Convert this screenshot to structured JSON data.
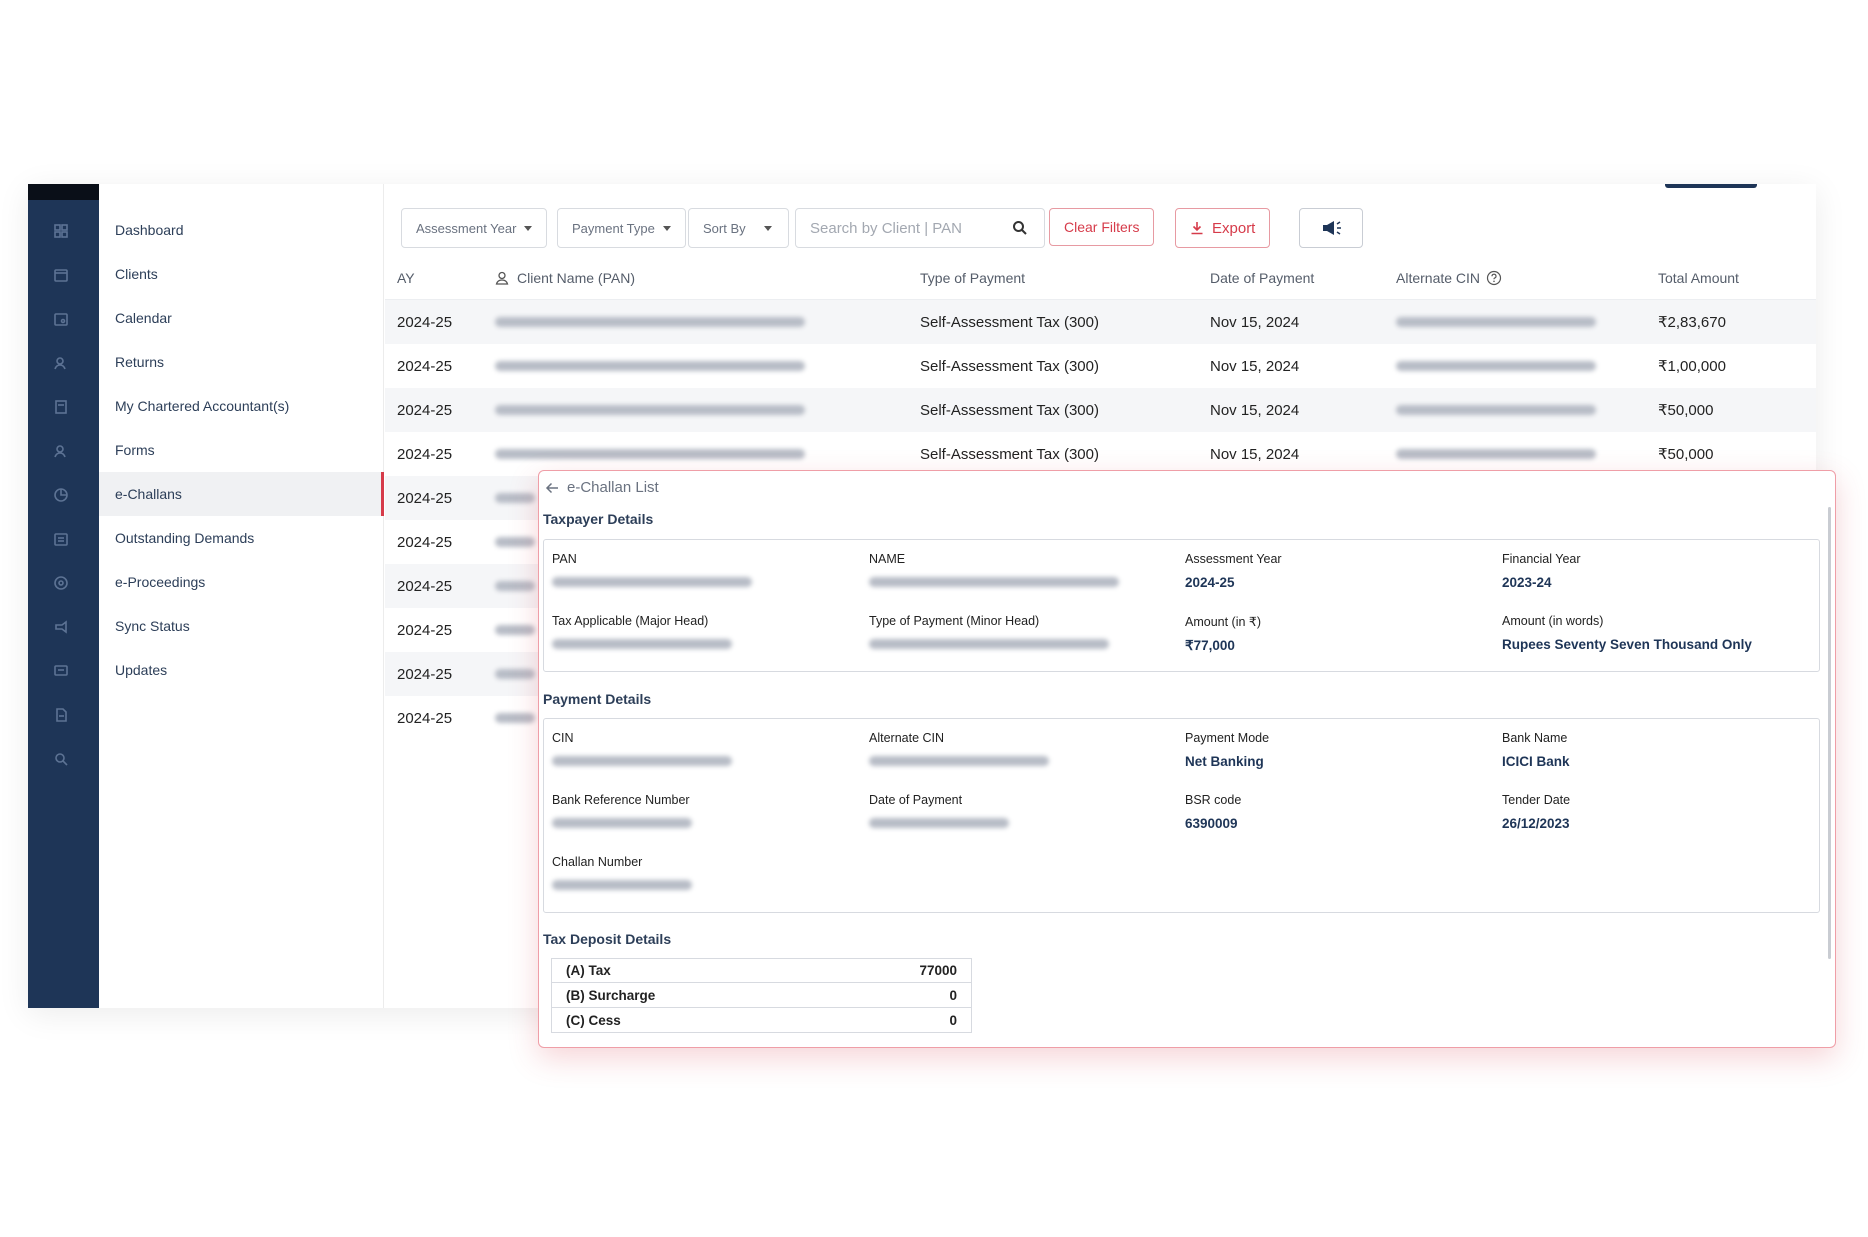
{
  "sidebar": {
    "items": [
      {
        "label": "Dashboard"
      },
      {
        "label": "Clients"
      },
      {
        "label": "Calendar"
      },
      {
        "label": "Returns"
      },
      {
        "label": "My Chartered Accountant(s)"
      },
      {
        "label": "Forms"
      },
      {
        "label": "e-Challans",
        "active": true
      },
      {
        "label": "Outstanding Demands"
      },
      {
        "label": "e-Proceedings"
      },
      {
        "label": "Sync Status"
      },
      {
        "label": "Updates"
      }
    ]
  },
  "toolbar": {
    "assessment_year": "Assessment Year",
    "payment_type": "Payment Type",
    "sort_by": "Sort By",
    "search_placeholder": "Search by Client | PAN",
    "clear_filters": "Clear Filters",
    "export": "Export"
  },
  "table": {
    "columns": [
      "AY",
      "Client Name (PAN)",
      "Type of Payment",
      "Date of Payment",
      "Alternate CIN",
      "Total Amount"
    ],
    "rows": [
      {
        "ay": "2024-25",
        "type": "Self-Assessment Tax (300)",
        "date": "Nov 15, 2024",
        "amount": "₹2,83,670"
      },
      {
        "ay": "2024-25",
        "type": "Self-Assessment Tax (300)",
        "date": "Nov 15, 2024",
        "amount": "₹1,00,000"
      },
      {
        "ay": "2024-25",
        "type": "Self-Assessment Tax (300)",
        "date": "Nov 15, 2024",
        "amount": "₹50,000"
      },
      {
        "ay": "2024-25",
        "type": "Self-Assessment Tax (300)",
        "date": "Nov 15, 2024",
        "amount": "₹50,000"
      },
      {
        "ay": "2024-25"
      },
      {
        "ay": "2024-25"
      },
      {
        "ay": "2024-25"
      },
      {
        "ay": "2024-25"
      },
      {
        "ay": "2024-25"
      },
      {
        "ay": "2024-25"
      }
    ]
  },
  "panel": {
    "back_label": "e-Challan List",
    "taxpayer": {
      "title": "Taxpayer Details",
      "pan_label": "PAN",
      "name_label": "NAME",
      "ay_label": "Assessment Year",
      "ay_value": "2024-25",
      "fy_label": "Financial Year",
      "fy_value": "2023-24",
      "major_head_label": "Tax Applicable (Major Head)",
      "minor_head_label": "Type of Payment (Minor Head)",
      "amount_label": "Amount (in ₹)",
      "amount_value": "₹77,000",
      "words_label": "Amount (in words)",
      "words_value": "Rupees Seventy Seven Thousand Only"
    },
    "payment": {
      "title": "Payment Details",
      "cin_label": "CIN",
      "alt_cin_label": "Alternate CIN",
      "mode_label": "Payment Mode",
      "mode_value": "Net Banking",
      "bank_label": "Bank Name",
      "bank_value": "ICICI Bank",
      "bank_ref_label": "Bank Reference Number",
      "date_label": "Date of Payment",
      "bsr_label": "BSR code",
      "bsr_value": "6390009",
      "tender_label": "Tender Date",
      "tender_value": "26/12/2023",
      "challan_label": "Challan Number"
    },
    "deposit": {
      "title": "Tax Deposit Details",
      "rows": [
        {
          "label": "(A) Tax",
          "value": "77000"
        },
        {
          "label": "(B) Surcharge",
          "value": "0"
        },
        {
          "label": "(C) Cess",
          "value": "0"
        }
      ]
    }
  }
}
